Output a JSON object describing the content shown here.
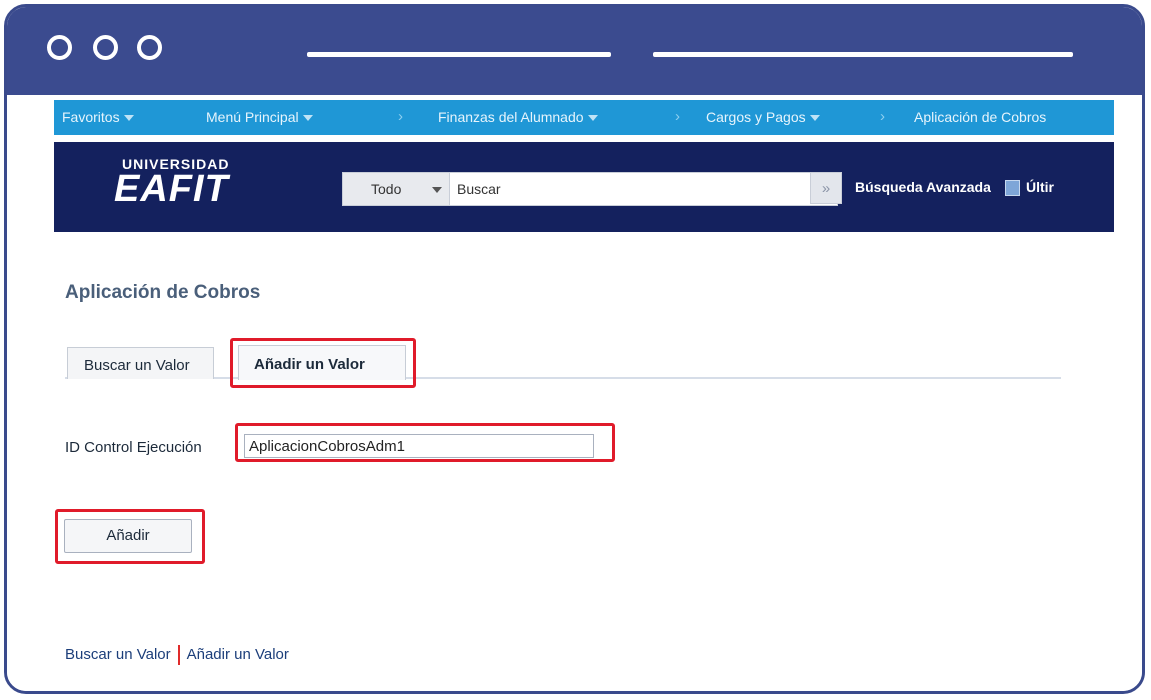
{
  "nav": {
    "items": [
      {
        "label": "Favoritos"
      },
      {
        "label": "Menú Principal"
      },
      {
        "label": "Finanzas del Alumnado"
      },
      {
        "label": "Cargos y Pagos"
      },
      {
        "label": "Aplicación de Cobros"
      }
    ],
    "separator": "›"
  },
  "header": {
    "logo_top": "UNIVERSIDAD",
    "logo_main": "EAFIT",
    "search_scope": "Todo",
    "search_placeholder": "Buscar",
    "go_symbol": "»",
    "advanced_search": "Búsqueda Avanzada",
    "recent": "Últir"
  },
  "page": {
    "title": "Aplicación de Cobros",
    "tabs": [
      {
        "label": "Buscar un Valor"
      },
      {
        "label": "Añadir un Valor"
      }
    ],
    "id_label": "ID Control Ejecución",
    "id_value": "AplicacionCobrosAdm1",
    "add_button": "Añadir"
  },
  "footer": {
    "link1": "Buscar un Valor",
    "link2": "Añadir un Valor"
  },
  "colors": {
    "frame": "#3b4b8f",
    "navbar": "#1f97d6",
    "header": "#14215e",
    "highlight": "#e01b2a"
  }
}
